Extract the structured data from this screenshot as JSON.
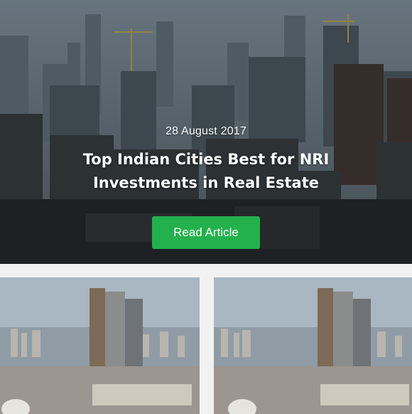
{
  "hero": {
    "date": "28 August 2017",
    "title": "Top Indian Cities Best for NRI Investments in Real Estate",
    "button_label": "Read Article",
    "accent_color": "#23b14d"
  },
  "cards": [
    {
      "image": "city-skyline-photo"
    },
    {
      "image": "city-skyline-photo"
    }
  ]
}
